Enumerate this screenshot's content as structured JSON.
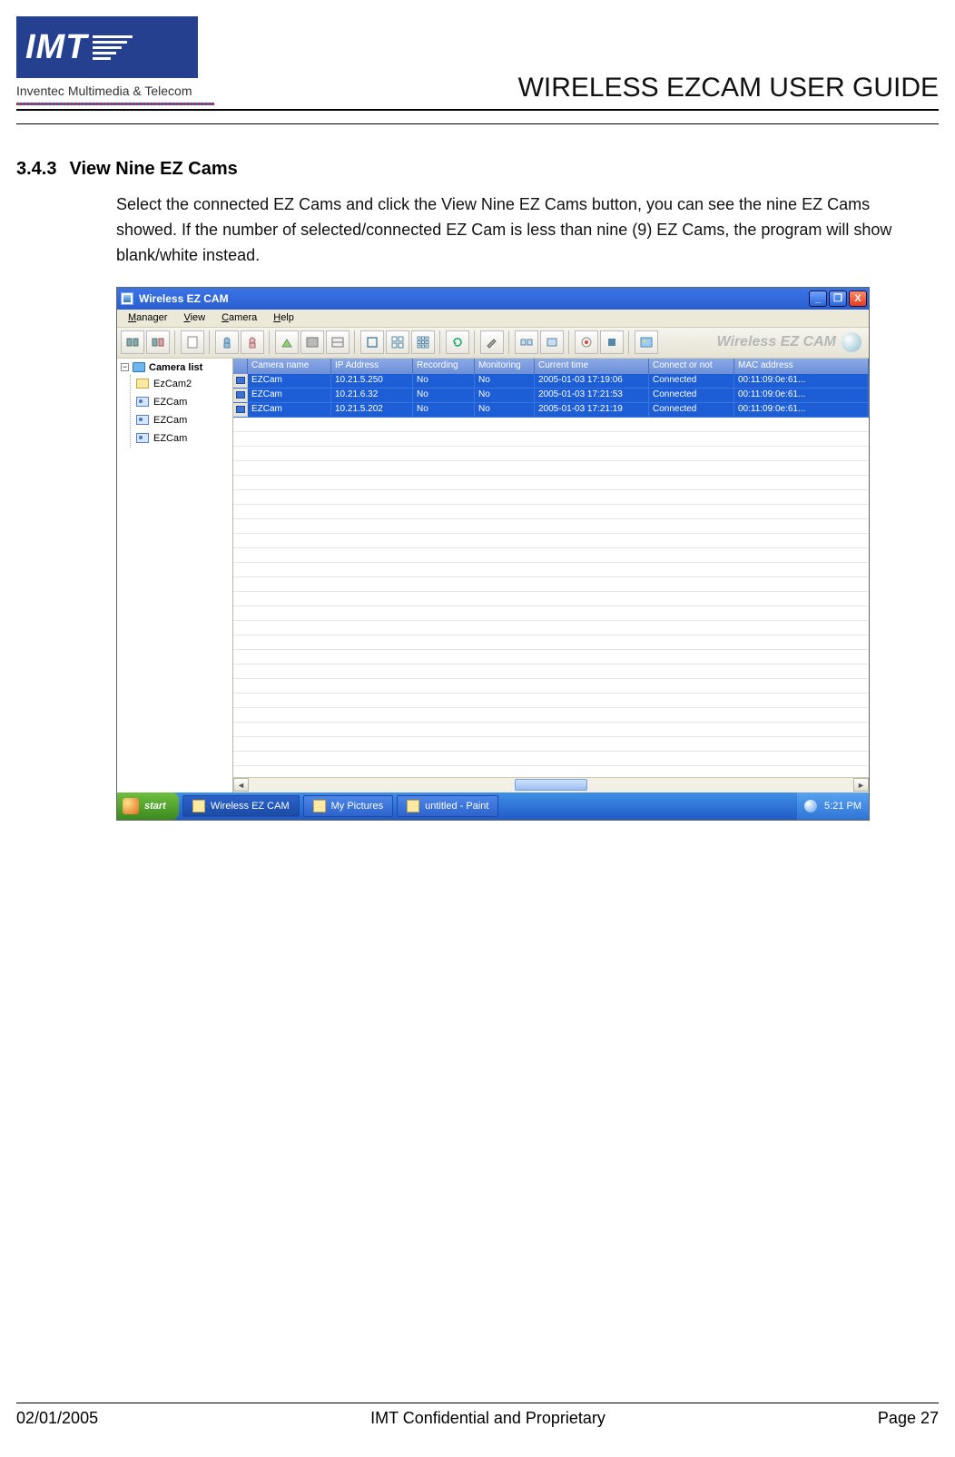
{
  "header": {
    "logo_text": "IMT",
    "logo_sub": "Inventec Multimedia & Telecom",
    "doc_title": "WIRELESS EZCAM USER GUIDE"
  },
  "section": {
    "number": "3.4.3",
    "title": "View Nine EZ Cams",
    "body": "Select the connected EZ Cams and click the View Nine EZ Cams button, you can see the nine EZ Cams showed.  If the number of selected/connected EZ Cam is less than nine (9) EZ Cams, the program will show blank/white instead."
  },
  "app": {
    "titlebar": {
      "title": "Wireless EZ CAM",
      "min": "_",
      "max": "❐",
      "close": "X"
    },
    "menu": [
      "Manager",
      "View",
      "Camera",
      "Help"
    ],
    "brand": "Wireless EZ CAM",
    "tree": {
      "root": "Camera list",
      "items": [
        "EzCam2",
        "EZCam",
        "EZCam",
        "EZCam"
      ]
    },
    "grid": {
      "headers": [
        "Camera name",
        "IP Address",
        "Recording",
        "Monitoring",
        "Current time",
        "Connect or not",
        "MAC address"
      ],
      "rows": [
        {
          "name": "EZCam",
          "ip": "10.21.5.250",
          "rec": "No",
          "mon": "No",
          "time": "2005-01-03 17:19:06",
          "conn": "Connected",
          "mac": "00:11:09:0e:61..."
        },
        {
          "name": "EZCam",
          "ip": "10.21.6.32",
          "rec": "No",
          "mon": "No",
          "time": "2005-01-03 17:21:53",
          "conn": "Connected",
          "mac": "00:11:09:0e:61..."
        },
        {
          "name": "EZCam",
          "ip": "10.21.5.202",
          "rec": "No",
          "mon": "No",
          "time": "2005-01-03 17:21:19",
          "conn": "Connected",
          "mac": "00:11:09:0e:61..."
        }
      ]
    },
    "taskbar": {
      "start": "start",
      "tasks": [
        "Wireless EZ CAM",
        "My Pictures",
        "untitled - Paint"
      ],
      "clock": "5:21 PM"
    }
  },
  "footer": {
    "left": "02/01/2005",
    "center": "IMT Confidential and Proprietary",
    "right": "Page 27"
  }
}
